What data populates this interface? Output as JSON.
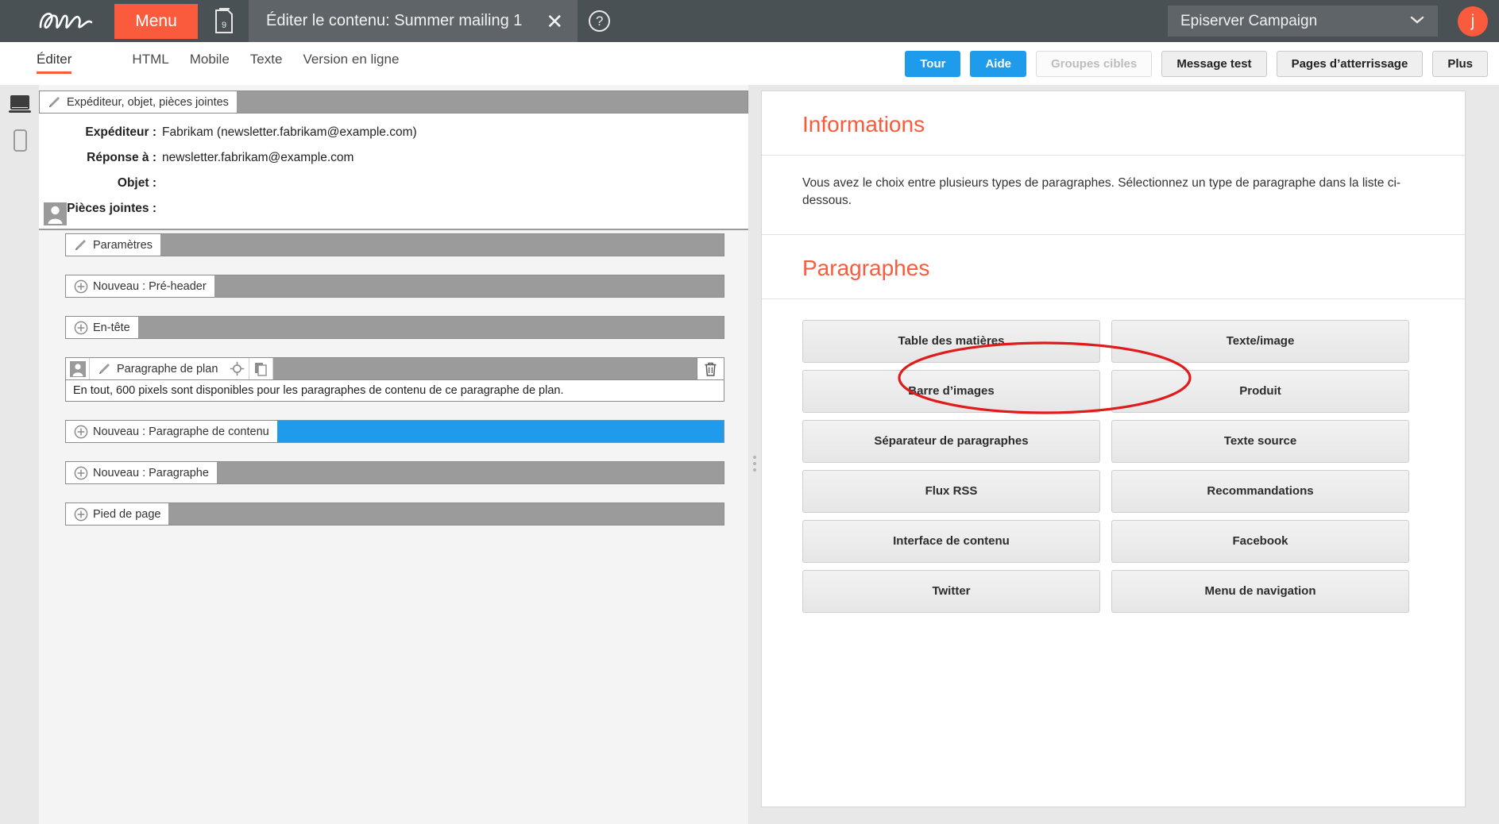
{
  "topbar": {
    "logo_alt": "episerver-logo",
    "menu_label": "Menu",
    "doc_badge": "9",
    "tab_title": "Éditer le contenu: Summer mailing 1",
    "tab_close": "✕",
    "help": "?",
    "client_name": "Episerver Campaign",
    "avatar_initial": "j",
    "accent_color": "#fa5b3d",
    "bar_color": "#4a5155"
  },
  "subbar": {
    "view_tabs": [
      {
        "label": "Éditer",
        "active": true
      },
      {
        "label": "HTML",
        "active": false
      },
      {
        "label": "Mobile",
        "active": false
      },
      {
        "label": "Texte",
        "active": false
      },
      {
        "label": "Version en ligne",
        "active": false
      }
    ],
    "actions": [
      {
        "label": "Tour",
        "style": "primary"
      },
      {
        "label": "Aide",
        "style": "primary"
      },
      {
        "label": "Groupes cibles",
        "style": "disabled"
      },
      {
        "label": "Message test",
        "style": "normal"
      },
      {
        "label": "Pages d’atterrissage",
        "style": "normal"
      },
      {
        "label": "Plus",
        "style": "normal"
      }
    ]
  },
  "device_rail": {
    "desktop_icon": "desktop-icon",
    "mobile_icon": "mobile-icon"
  },
  "editor": {
    "sender_bar_label": "Expéditeur, objet, pièces jointes",
    "fields": [
      {
        "label": "Expéditeur :",
        "value": "Fabrikam (newsletter.fabrikam@example.com)"
      },
      {
        "label": "Réponse à :",
        "value": "newsletter.fabrikam@example.com"
      },
      {
        "label": "Objet :",
        "value": ""
      },
      {
        "label": "Pièces jointes :",
        "value": ""
      }
    ],
    "blocks": [
      {
        "type": "pencil",
        "label": "Paramètres",
        "fill": "grey"
      },
      {
        "type": "plus",
        "label": "Nouveau : Pré-header",
        "fill": "grey"
      },
      {
        "type": "plus",
        "label": "En-tête",
        "fill": "grey"
      },
      {
        "type": "plan",
        "label": "Paragraphe de plan",
        "fill": "grey",
        "hint": "En tout, 600 pixels sont disponibles pour les paragraphes de contenu de ce paragraphe de plan."
      },
      {
        "type": "plus",
        "label": "Nouveau : Paragraphe de contenu",
        "fill": "blue"
      },
      {
        "type": "plus",
        "label": "Nouveau : Paragraphe",
        "fill": "grey"
      },
      {
        "type": "plus",
        "label": "Pied de page",
        "fill": "grey"
      }
    ]
  },
  "info_panel": {
    "informations_title": "Informations",
    "informations_text": "Vous avez le choix entre plusieurs types de paragraphes. Sélectionnez un type de paragraphe dans la liste ci-dessous.",
    "paragraphes_title": "Paragraphes",
    "paragraph_buttons": [
      "Table des matières",
      "Texte/image",
      "Barre d’images",
      "Produit",
      "Séparateur de paragraphes",
      "Texte source",
      "Flux RSS",
      "Recommandations",
      "Interface de contenu",
      "Facebook",
      "Twitter",
      "Menu de navigation"
    ],
    "highlight_color": "#e01b1b",
    "highlighted_button": "Texte/image"
  }
}
